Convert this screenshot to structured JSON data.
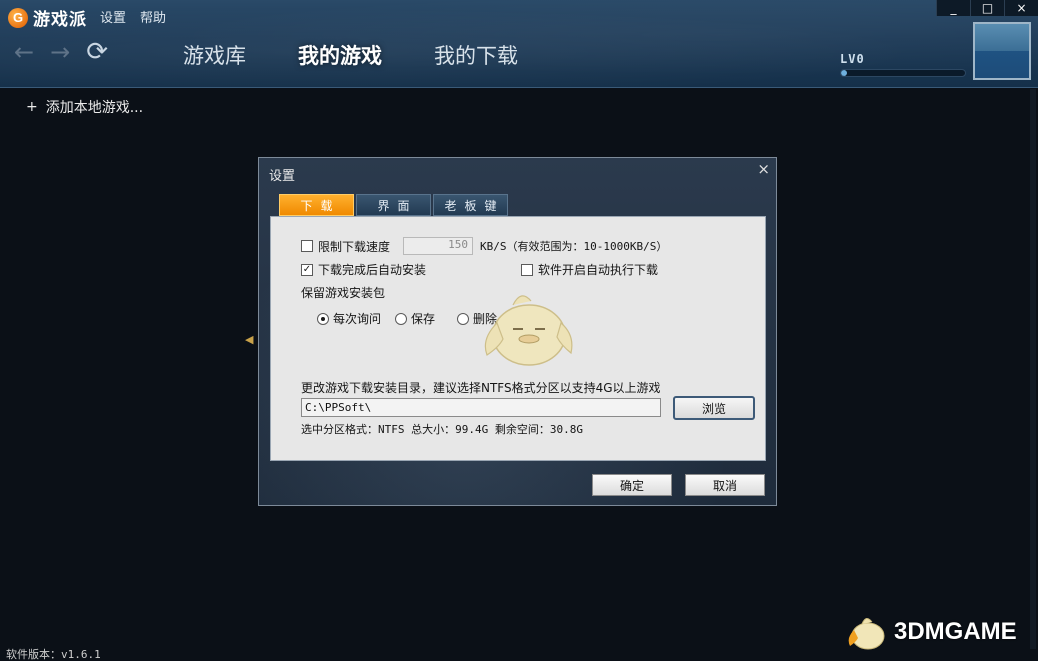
{
  "app": {
    "logo_letter": "G",
    "name": "游戏派",
    "menu": [
      "设置",
      "帮助"
    ],
    "window_controls": [
      "_",
      "□",
      "×"
    ]
  },
  "nav": {
    "back_icon": "←",
    "forward_icon": "→",
    "refresh_icon": "⟳",
    "tabs": [
      {
        "label": "游戏库",
        "active": false
      },
      {
        "label": "我的游戏",
        "active": true
      },
      {
        "label": "我的下载",
        "active": false
      }
    ]
  },
  "user": {
    "level_label": "LV0",
    "level_progress_fraction": 0.05
  },
  "content": {
    "add_local_icon": "+",
    "add_local_label": "添加本地游戏..."
  },
  "dialog": {
    "title": "设置",
    "close_icon": "×",
    "tabs": [
      {
        "label": "下载",
        "active": true
      },
      {
        "label": "界面",
        "active": false
      },
      {
        "label": "老板键",
        "active": false
      }
    ],
    "limit_speed": {
      "label": "限制下载速度",
      "checked": false,
      "value": "150",
      "unit_note": "KB/S（有效范围为：10-1000KB/S）"
    },
    "auto_install": {
      "label": "下载完成后自动安装",
      "checked": true
    },
    "auto_download_on_start": {
      "label": "软件开启自动执行下载",
      "checked": false
    },
    "keep_package": {
      "label": "保留游戏安装包",
      "options": [
        {
          "label": "每次询问",
          "selected": true
        },
        {
          "label": "保存",
          "selected": false
        },
        {
          "label": "删除",
          "selected": false
        }
      ]
    },
    "dir_label": "更改游戏下载安装目录，建议选择NTFS格式分区以支持4G以上游戏",
    "dir_value": "C:\\PPSoft\\",
    "browse_label": "浏览",
    "partition_info": "选中分区格式：NTFS 总大小：99.4G 剩余空间：30.8G",
    "ok_label": "确定",
    "cancel_label": "取消"
  },
  "status": {
    "version": "软件版本：v1.6.1"
  },
  "watermark": {
    "text": "3DMGAME"
  },
  "colors": {
    "header_bg": "#1d3a57",
    "active_tab": "#f59a0f",
    "panel_bg": "#e7e7e7",
    "content_bg": "#0b1017"
  }
}
